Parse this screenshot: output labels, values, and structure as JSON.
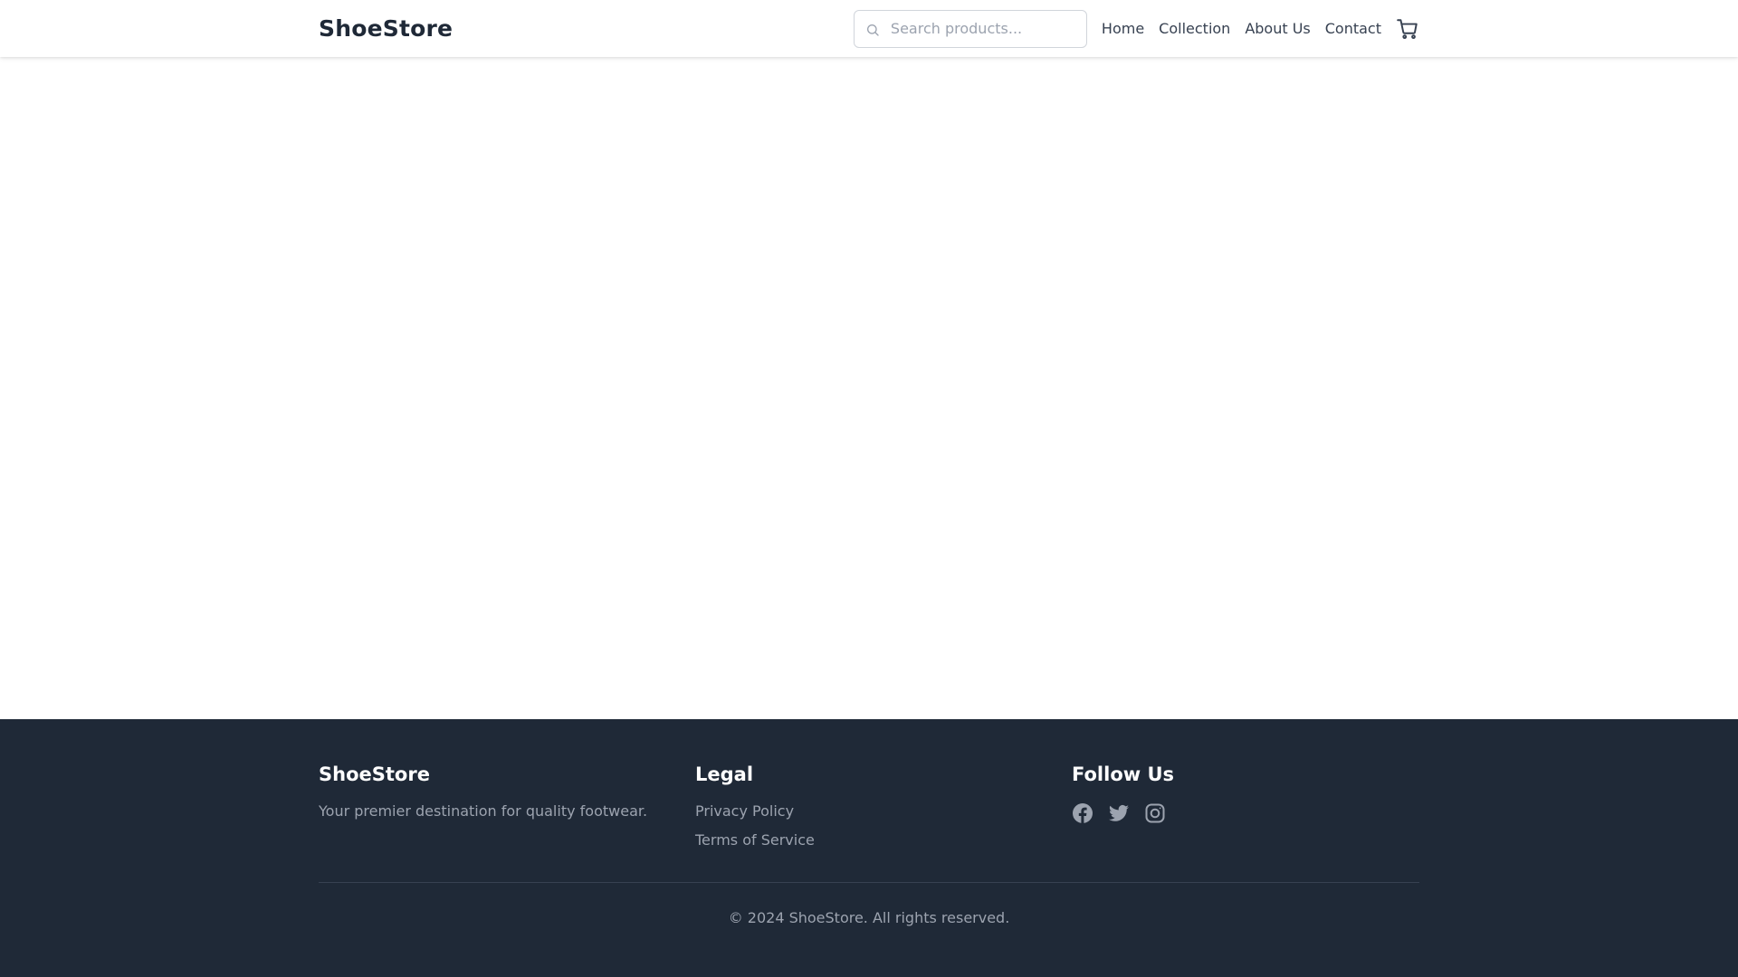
{
  "header": {
    "logo": "ShoeStore",
    "search": {
      "placeholder": "Search products...",
      "value": "",
      "icon": "search-icon"
    },
    "nav": [
      {
        "label": "Home"
      },
      {
        "label": "Collection"
      },
      {
        "label": "About Us"
      },
      {
        "label": "Contact"
      }
    ],
    "cart_icon": "cart-icon"
  },
  "footer": {
    "brand": {
      "title": "ShoeStore",
      "tagline": "Your premier destination for quality footwear."
    },
    "legal": {
      "title": "Legal",
      "links": [
        {
          "label": "Privacy Policy"
        },
        {
          "label": "Terms of Service"
        }
      ]
    },
    "social": {
      "title": "Follow Us",
      "icons": [
        "facebook-icon",
        "twitter-icon",
        "instagram-icon"
      ]
    },
    "copyright": "© 2024 ShoeStore. All rights reserved."
  },
  "colors": {
    "header_bg": "#ffffff",
    "footer_bg": "#1f2937",
    "text_dark": "#1f2937",
    "text_muted": "#9ca3af"
  }
}
